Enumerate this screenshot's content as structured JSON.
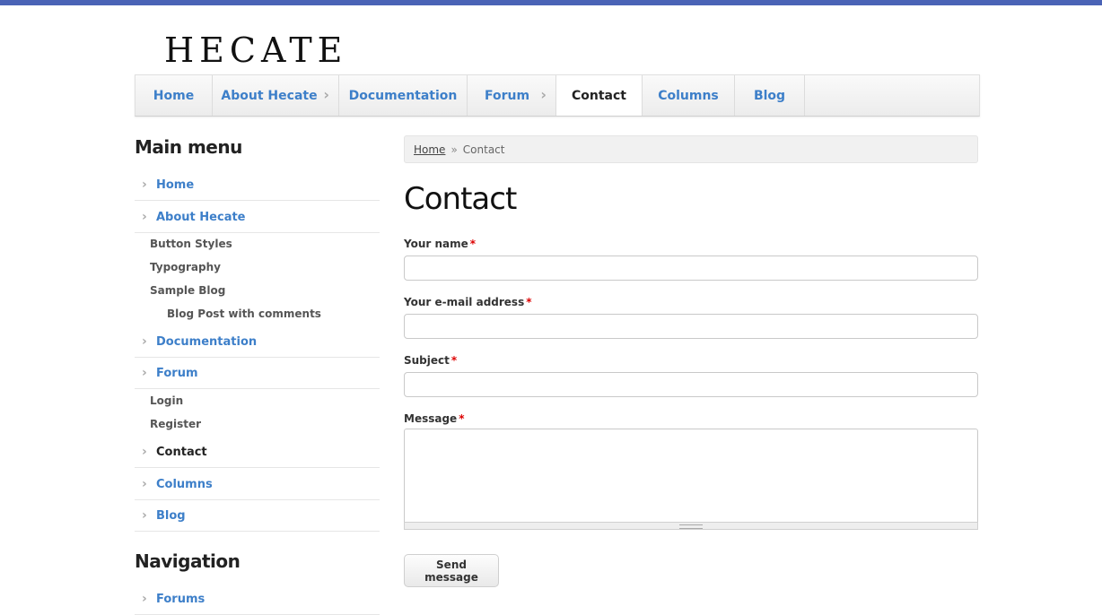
{
  "site": {
    "logo": "HECATE"
  },
  "nav": {
    "items": [
      {
        "label": "Home"
      },
      {
        "label": "About Hecate"
      },
      {
        "label": "Documentation"
      },
      {
        "label": "Forum"
      },
      {
        "label": "Contact"
      },
      {
        "label": "Columns"
      },
      {
        "label": "Blog"
      }
    ]
  },
  "sidebar": {
    "main_title": "Main menu",
    "items": {
      "home": "Home",
      "about": "About Hecate",
      "button_styles": "Button Styles",
      "typography": "Typography",
      "sample_blog": "Sample Blog",
      "blog_post": "Blog Post with comments",
      "documentation": "Documentation",
      "forum": "Forum",
      "login": "Login",
      "register": "Register",
      "contact": "Contact",
      "columns": "Columns",
      "blog": "Blog"
    },
    "nav_title": "Navigation",
    "forums": "Forums"
  },
  "breadcrumb": {
    "home": "Home",
    "sep": "»",
    "current": "Contact"
  },
  "page": {
    "title": "Contact"
  },
  "form": {
    "name_label": "Your name",
    "email_label": "Your e-mail address",
    "subject_label": "Subject",
    "message_label": "Message",
    "required_mark": "*",
    "submit_label": "Send message"
  },
  "colors": {
    "accent": "#3d7fc9",
    "topbar": "#4a63b6",
    "required": "#dd0000"
  },
  "icons": {
    "chevron": "chevron-right-icon",
    "resize": "resize-grip-icon"
  }
}
